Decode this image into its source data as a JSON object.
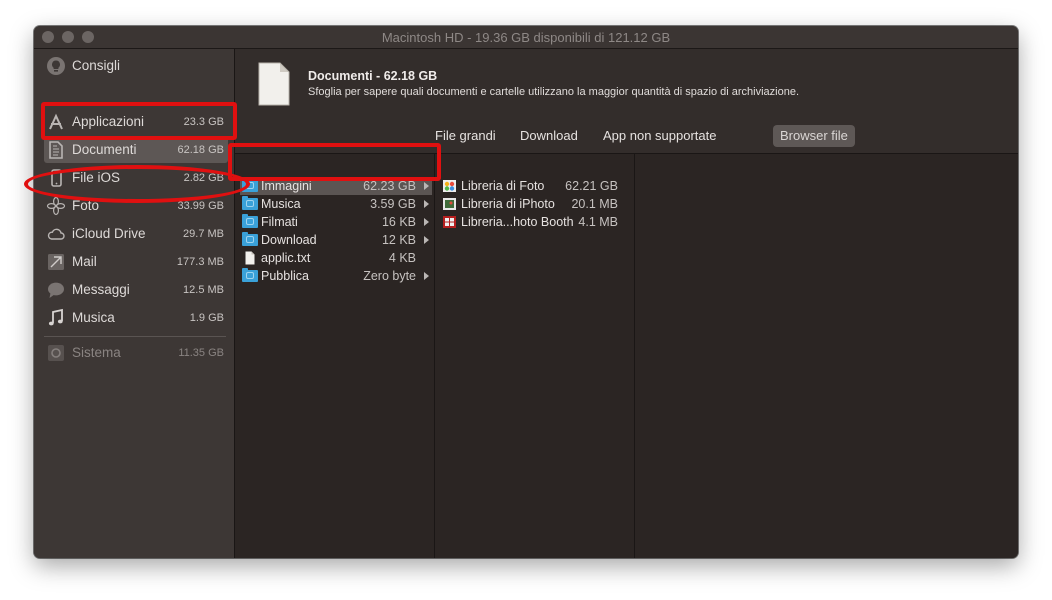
{
  "window": {
    "title": "Macintosh HD - 19.36 GB disponibili di 121.12 GB"
  },
  "sidebar": {
    "items": [
      {
        "label": "Consigli",
        "size": "",
        "icon": "lightbulb-icon"
      },
      {
        "label": "Applicazioni",
        "size": "23.3 GB",
        "icon": "apps-icon"
      },
      {
        "label": "Documenti",
        "size": "62.18 GB",
        "icon": "document-icon"
      },
      {
        "label": "File iOS",
        "size": "2.82 GB",
        "icon": "iphone-icon"
      },
      {
        "label": "Foto",
        "size": "33.99 GB",
        "icon": "photos-icon"
      },
      {
        "label": "iCloud Drive",
        "size": "29.7 MB",
        "icon": "cloud-icon"
      },
      {
        "label": "Mail",
        "size": "177.3 MB",
        "icon": "mail-icon"
      },
      {
        "label": "Messaggi",
        "size": "12.5 MB",
        "icon": "messages-icon"
      },
      {
        "label": "Musica",
        "size": "1.9 GB",
        "icon": "music-note-icon"
      },
      {
        "label": "Sistema",
        "size": "11.35 GB",
        "icon": "system-icon"
      }
    ]
  },
  "header": {
    "title": "Documenti - 62.18 GB",
    "subtitle": "Sfoglia per sapere quali documenti e cartelle utilizzano la maggior quantità di spazio di archiviazione."
  },
  "tabs": [
    {
      "label": "File grandi",
      "active": false
    },
    {
      "label": "Download",
      "active": false
    },
    {
      "label": "App non supportate",
      "active": false
    },
    {
      "label": "Browser file",
      "active": true
    }
  ],
  "browser": {
    "column1": [
      {
        "name": "Immagini",
        "size": "62.23 GB",
        "type": "folder",
        "arrow": true,
        "selected": true
      },
      {
        "name": "Musica",
        "size": "3.59 GB",
        "type": "folder",
        "arrow": true
      },
      {
        "name": "Filmati",
        "size": "16 KB",
        "type": "folder",
        "arrow": true
      },
      {
        "name": "Download",
        "size": "12 KB",
        "type": "folder",
        "arrow": true
      },
      {
        "name": "applic.txt",
        "size": "4 KB",
        "type": "file",
        "arrow": false
      },
      {
        "name": "Pubblica",
        "size": "Zero byte",
        "type": "folder",
        "arrow": true
      }
    ],
    "column2": [
      {
        "name": "Libreria di Foto",
        "size": "62.21 GB",
        "icon": "photos-library-icon"
      },
      {
        "name": "Libreria di iPhoto",
        "size": "20.1 MB",
        "icon": "iphoto-library-icon"
      },
      {
        "name": "Libreria...hoto Booth",
        "size": "4.1 MB",
        "icon": "photo-booth-library-icon"
      }
    ]
  },
  "colors": {
    "window_bg": "#2b2523",
    "sidebar_bg": "#3d3735",
    "folder_blue": "#3aa1d9",
    "annotation_red": "#e01010"
  }
}
